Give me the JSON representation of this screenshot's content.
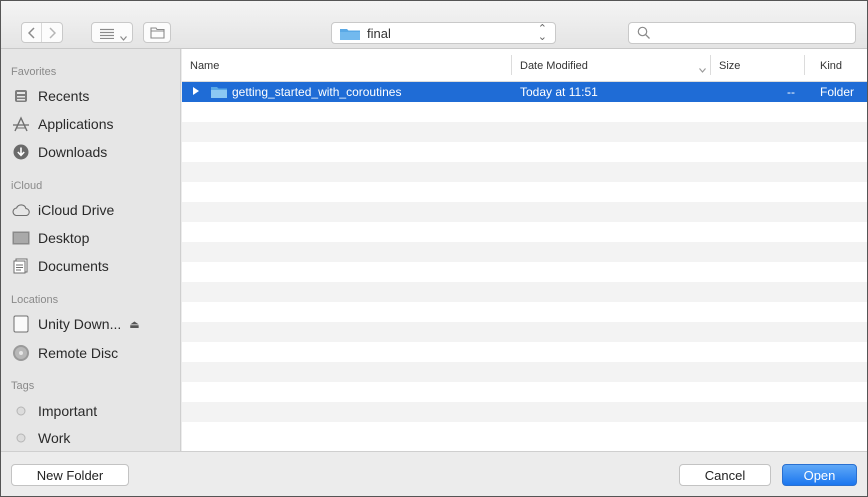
{
  "toolbar": {
    "back_icon": "chevron-left-icon",
    "forward_icon": "chevron-right-icon",
    "view_icon": "list-view-icon",
    "new_folder_icon": "new-folder-icon",
    "path_label": "final",
    "search_placeholder": ""
  },
  "sidebar": {
    "sections": [
      {
        "title": "Favorites",
        "items": [
          {
            "label": "Recents",
            "icon": "recents-icon"
          },
          {
            "label": "Applications",
            "icon": "applications-icon"
          },
          {
            "label": "Downloads",
            "icon": "downloads-icon"
          }
        ]
      },
      {
        "title": "iCloud",
        "items": [
          {
            "label": "iCloud Drive",
            "icon": "cloud-icon"
          },
          {
            "label": "Desktop",
            "icon": "desktop-icon"
          },
          {
            "label": "Documents",
            "icon": "documents-icon"
          }
        ]
      },
      {
        "title": "Locations",
        "items": [
          {
            "label": "Unity Down...",
            "icon": "disk-icon",
            "eject": "⏏"
          },
          {
            "label": "Remote Disc",
            "icon": "remote-disc-icon"
          }
        ]
      },
      {
        "title": "Tags",
        "items": [
          {
            "label": "Important",
            "icon": "tag-dot-icon"
          },
          {
            "label": "Work",
            "icon": "tag-dot-icon"
          }
        ]
      }
    ]
  },
  "list": {
    "columns": [
      "Name",
      "Date Modified",
      "Size",
      "Kind"
    ],
    "rows": [
      {
        "name": "getting_started_with_coroutines",
        "date": "Today at 11:51",
        "size": "--",
        "kind": "Folder",
        "selected": true
      }
    ],
    "empty_rows": 17
  },
  "buttons": {
    "new_folder": "New Folder",
    "cancel": "Cancel",
    "open": "Open"
  },
  "colors": {
    "selection": "#1f6cd6",
    "folder": "#5aa9e6",
    "primary_button": "#1b76ef"
  }
}
